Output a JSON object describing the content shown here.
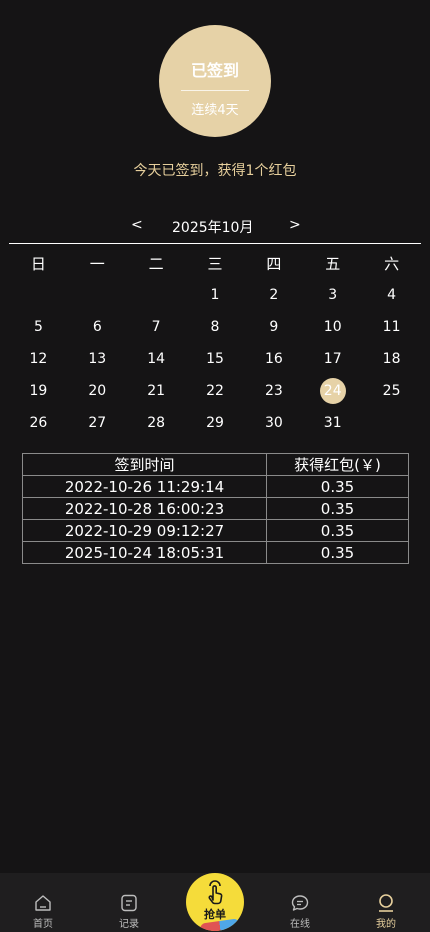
{
  "sign": {
    "title": "已签到",
    "subtitle": "连续4天"
  },
  "today_message": "今天已签到，获得1个红包",
  "calendar": {
    "prev": "<",
    "month": "2025年10月",
    "next": ">",
    "weekdays": [
      "日",
      "一",
      "二",
      "三",
      "四",
      "五",
      "六"
    ],
    "leading_blanks": 3,
    "days": [
      "1",
      "2",
      "3",
      "4",
      "5",
      "6",
      "7",
      "8",
      "9",
      "10",
      "11",
      "12",
      "13",
      "14",
      "15",
      "16",
      "17",
      "18",
      "19",
      "20",
      "21",
      "22",
      "23",
      "24",
      "25",
      "26",
      "27",
      "28",
      "29",
      "30",
      "31"
    ],
    "highlight_day": "24",
    "highlight_color": "#e6d2a7"
  },
  "records": {
    "headers": [
      "签到时间",
      "获得红包(￥)"
    ],
    "rows": [
      [
        "2022-10-26 11:29:14",
        "0.35"
      ],
      [
        "2022-10-28 16:00:23",
        "0.35"
      ],
      [
        "2022-10-29 09:12:27",
        "0.35"
      ],
      [
        "2025-10-24 18:05:31",
        "0.35"
      ]
    ]
  },
  "tabbar": {
    "home": "首页",
    "records": "记录",
    "grab": "抢单",
    "online": "在线",
    "mine": "我的",
    "active": "mine",
    "active_color": "#e6cf9c"
  }
}
